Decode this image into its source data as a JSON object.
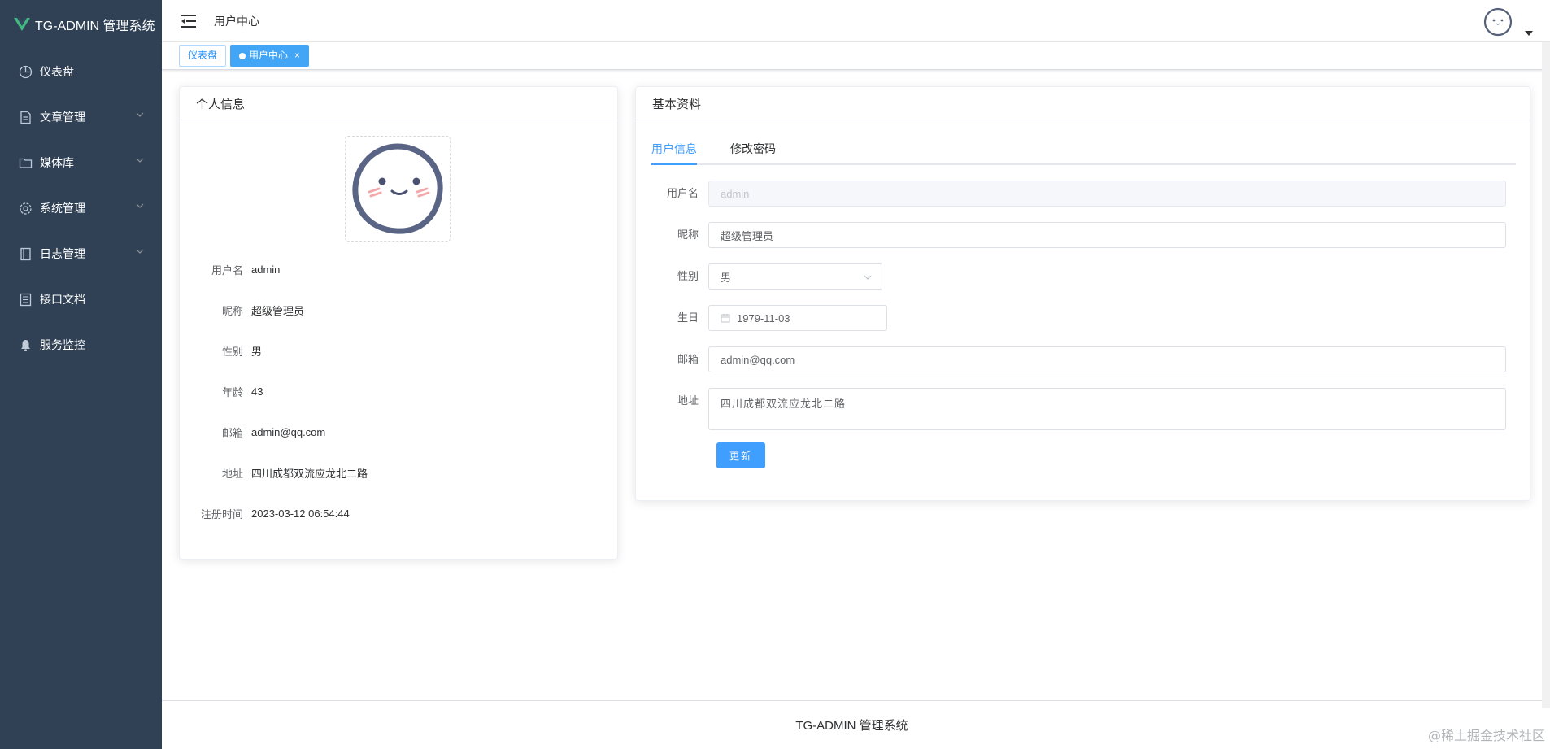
{
  "app": {
    "title": "TG-ADMIN 管理系统",
    "brand_color": "#42b983"
  },
  "sidebar": {
    "items": [
      {
        "label": "仪表盘",
        "icon": "dashboard-icon",
        "has_children": false
      },
      {
        "label": "文章管理",
        "icon": "document-icon",
        "has_children": true
      },
      {
        "label": "媒体库",
        "icon": "folder-icon",
        "has_children": true
      },
      {
        "label": "系统管理",
        "icon": "gear-icon",
        "has_children": true
      },
      {
        "label": "日志管理",
        "icon": "notebook-icon",
        "has_children": true
      },
      {
        "label": "接口文档",
        "icon": "list-doc-icon",
        "has_children": false
      },
      {
        "label": "服务监控",
        "icon": "bell-icon",
        "has_children": false
      }
    ]
  },
  "header": {
    "breadcrumb": "用户中心"
  },
  "tags": [
    {
      "label": "仪表盘",
      "active": false
    },
    {
      "label": "用户中心",
      "active": true,
      "close": "×"
    }
  ],
  "profile": {
    "title": "个人信息",
    "fields": [
      {
        "label": "用户名",
        "value": "admin"
      },
      {
        "label": "昵称",
        "value": "超级管理员"
      },
      {
        "label": "性别",
        "value": "男"
      },
      {
        "label": "年龄",
        "value": "43"
      },
      {
        "label": "邮箱",
        "value": "admin@qq.com"
      },
      {
        "label": "地址",
        "value": "四川成都双流应龙北二路"
      },
      {
        "label": "注册时间",
        "value": "2023-03-12 06:54:44"
      }
    ]
  },
  "basic": {
    "title": "基本资料",
    "tabs": [
      "用户信息",
      "修改密码"
    ],
    "form": {
      "username_label": "用户名",
      "username_value": "admin",
      "nickname_label": "昵称",
      "nickname_value": "超级管理员",
      "gender_label": "性别",
      "gender_value": "男",
      "birthday_label": "生日",
      "birthday_value": "1979-11-03",
      "email_label": "邮箱",
      "email_value": "admin@qq.com",
      "address_label": "地址",
      "address_value": "四川成都双流应龙北二路"
    },
    "submit_label": "更新"
  },
  "footer": {
    "text": "TG-ADMIN 管理系统"
  },
  "watermark": "@稀土掘金技术社区"
}
